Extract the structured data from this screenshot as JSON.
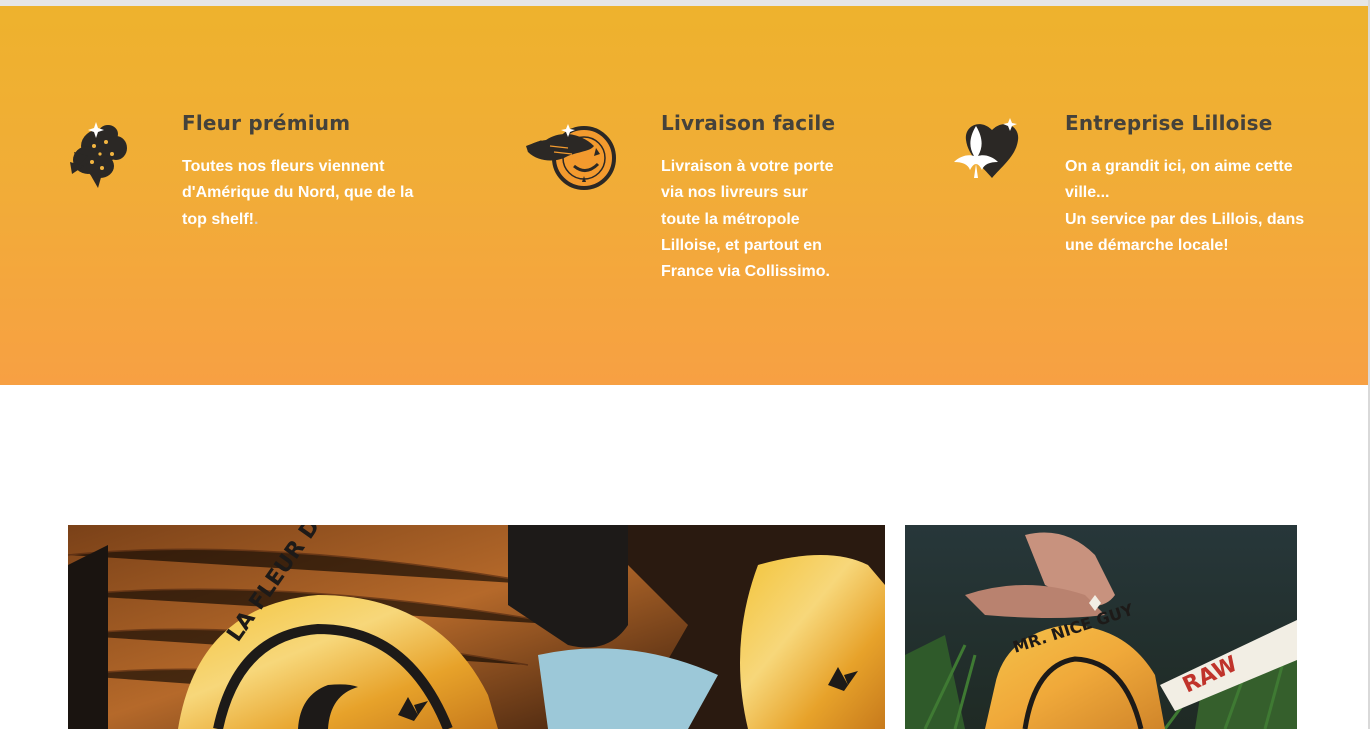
{
  "features": [
    {
      "icon": "cannabis-bud-icon",
      "title": "Fleur prémium",
      "text_lines": [
        "Toutes nos fleurs viennent d'Amérique du Nord, que de la top shelf!"
      ],
      "text_trailing": "."
    },
    {
      "icon": "mr-nice-guy-logo-icon",
      "title": "Livraison facile",
      "text_lines": [
        "Livraison à votre porte via nos livreurs sur toute la métropole Lilloise, et partout en France via Collissimo."
      ]
    },
    {
      "icon": "fleur-de-lis-heart-icon",
      "title": "Entreprise Lilloise",
      "text_lines": [
        "On a grandit ici, on aime cette ville...",
        "Un service par des Lillois, dans une démarche locale!"
      ]
    }
  ],
  "photos": [
    {
      "name": "product-photo-pouches",
      "logo_text": "LA FLEUR DE LILLE"
    },
    {
      "name": "product-photo-raw-cone",
      "logo_text": "MR. NICE GUY",
      "brand_text": "RAW"
    }
  ],
  "colors": {
    "band_top": "#eeb22d",
    "band_bottom": "#f7a043",
    "title": "#45423b",
    "text": "#ffffff",
    "icon": "#2b2825"
  }
}
